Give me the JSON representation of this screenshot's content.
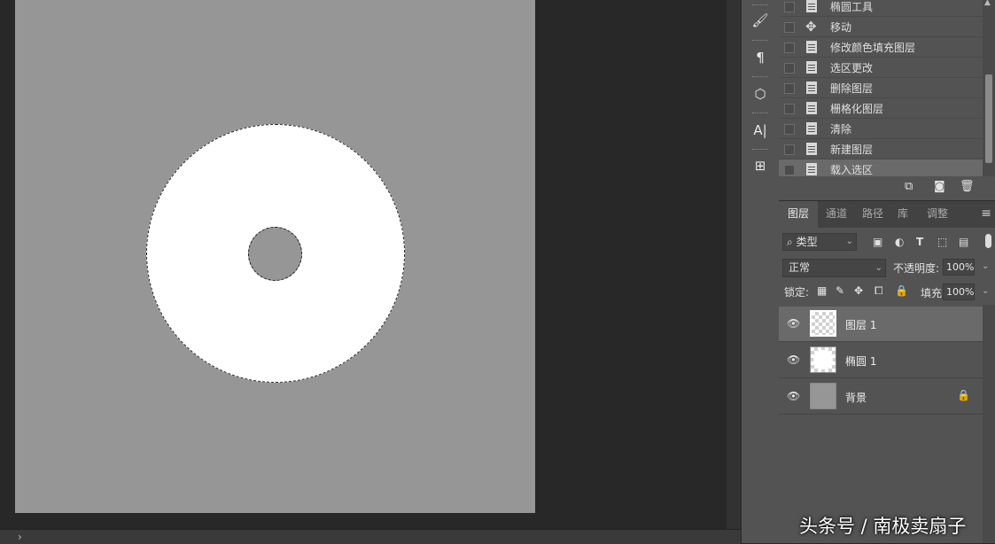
{
  "history": {
    "items": [
      {
        "label": "椭圆工具",
        "icon": "document-icon"
      },
      {
        "label": "移动",
        "icon": "move-icon"
      },
      {
        "label": "修改颜色填充图层",
        "icon": "document-icon"
      },
      {
        "label": "选区更改",
        "icon": "document-icon"
      },
      {
        "label": "删除图层",
        "icon": "document-icon"
      },
      {
        "label": "栅格化图层",
        "icon": "document-icon"
      },
      {
        "label": "清除",
        "icon": "document-icon"
      },
      {
        "label": "新建图层",
        "icon": "document-icon"
      },
      {
        "label": "载入选区",
        "icon": "document-icon",
        "selected": true
      }
    ]
  },
  "layers_panel": {
    "tabs": [
      "图层",
      "通道",
      "路径",
      "库",
      "调整"
    ],
    "active_tab": "图层",
    "filter_kind": "类型",
    "blend_mode": "正常",
    "opacity_label": "不透明度:",
    "opacity_value": "100%",
    "lock_label": "锁定:",
    "fill_label": "填充:",
    "fill_value": "100%",
    "layers": [
      {
        "name": "图层 1",
        "thumb": "transparent",
        "selected": true,
        "locked": false
      },
      {
        "name": "椭圆 1",
        "thumb": "white-circle",
        "selected": false,
        "locked": false
      },
      {
        "name": "背景",
        "thumb": "gray-fill",
        "selected": false,
        "locked": true
      }
    ]
  },
  "colors": {
    "canvas_bg": "#969696",
    "workspace_bg": "#282828",
    "panel_bg": "#535353",
    "shape_fill": "#ffffff"
  },
  "watermark": "头条号 / 南极卖扇子"
}
